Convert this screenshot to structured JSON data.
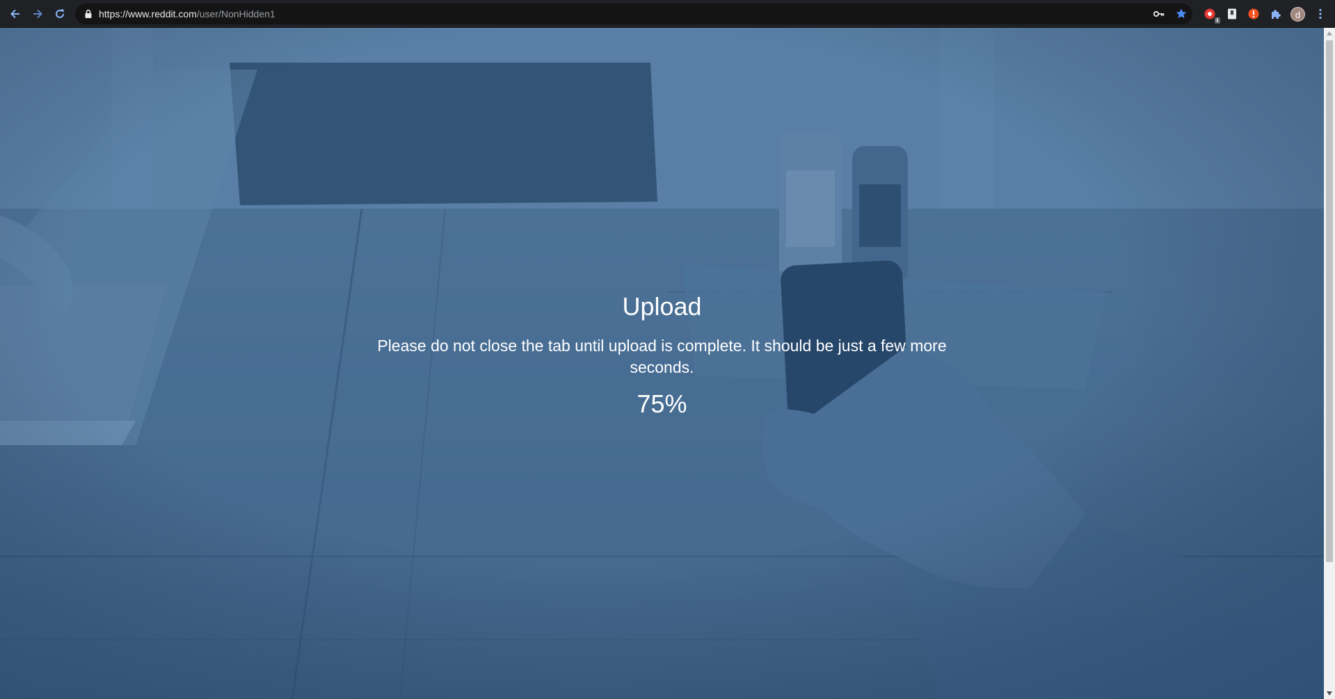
{
  "browser": {
    "url_host": "https://www.reddit.com",
    "url_path": "/user/NonHidden1",
    "profile_initial": "d",
    "extension_badge": "4",
    "icons": {
      "back": "arrow-left-icon",
      "forward": "arrow-right-icon",
      "reload": "reload-icon",
      "lock": "lock-icon",
      "key": "key-icon",
      "bookmark": "star-icon",
      "ext1": "red-circle-extension-icon",
      "ext2": "bookmark-extension-icon",
      "ext3": "alert-extension-icon",
      "extensions": "puzzle-icon",
      "menu": "kebab-menu-icon"
    }
  },
  "page": {
    "title": "Upload",
    "message": "Please do not close the tab until upload is complete. It should be just a few more seconds.",
    "progress_text": "75%",
    "progress": 0.75
  },
  "colors": {
    "overlay": "#3f6a95",
    "text": "#ffffff",
    "toolbar": "#202124",
    "accent_star": "#4c8bf5"
  }
}
